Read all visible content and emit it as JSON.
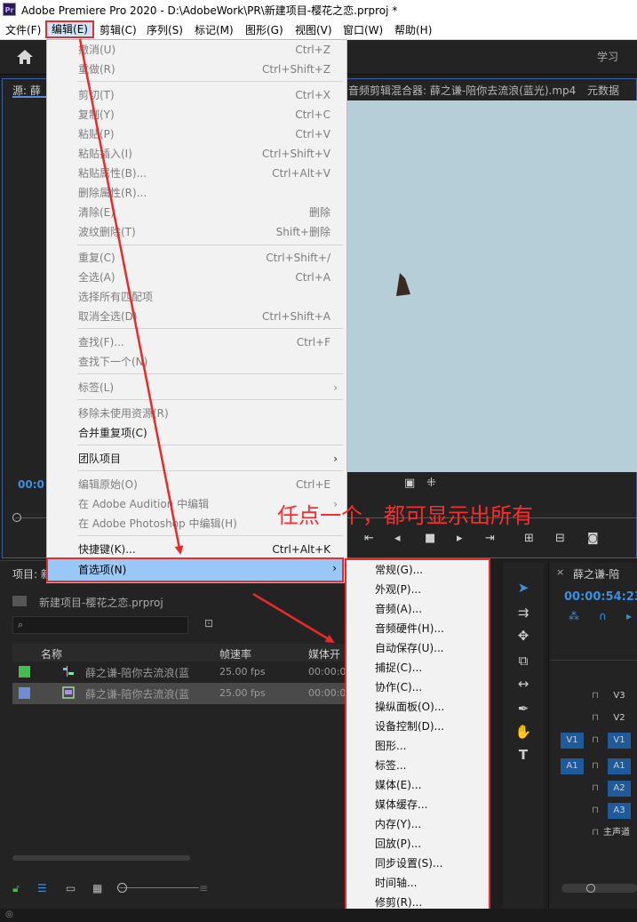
{
  "window": {
    "title": "Adobe Premiere Pro 2020 - D:\\AdobeWork\\PR\\新建项目-樱花之恋.prproj *",
    "icon_text": "Pr"
  },
  "menubar": [
    {
      "label": "文件(F)"
    },
    {
      "label": "编辑(E)"
    },
    {
      "label": "剪辑(C)"
    },
    {
      "label": "序列(S)"
    },
    {
      "label": "标记(M)"
    },
    {
      "label": "图形(G)"
    },
    {
      "label": "视图(V)"
    },
    {
      "label": "窗口(W)"
    },
    {
      "label": "帮助(H)"
    }
  ],
  "header": {
    "learn": "学习"
  },
  "source_panel": {
    "tab": "源: 薛",
    "mixer_tab": "音频剪辑混合器: 薛之谦-陪你去流浪(蓝光).mp4",
    "metadata_tab": "元数据",
    "timecode": "00:0"
  },
  "edit_menu": [
    {
      "label": "撤消(U)",
      "shortcut": "Ctrl+Z",
      "enabled": false
    },
    {
      "label": "重做(R)",
      "shortcut": "Ctrl+Shift+Z",
      "enabled": false
    },
    {
      "label": "剪切(T)",
      "shortcut": "Ctrl+X",
      "enabled": false
    },
    {
      "label": "复制(Y)",
      "shortcut": "Ctrl+C",
      "enabled": false
    },
    {
      "label": "粘贴(P)",
      "shortcut": "Ctrl+V",
      "enabled": false
    },
    {
      "label": "粘贴插入(I)",
      "shortcut": "Ctrl+Shift+V",
      "enabled": false
    },
    {
      "label": "粘贴属性(B)...",
      "shortcut": "Ctrl+Alt+V",
      "enabled": false
    },
    {
      "label": "删除属性(R)...",
      "shortcut": "",
      "enabled": false
    },
    {
      "label": "清除(E)",
      "shortcut": "删除",
      "enabled": false
    },
    {
      "label": "波纹删除(T)",
      "shortcut": "Shift+删除",
      "enabled": false
    },
    {
      "label": "重复(C)",
      "shortcut": "Ctrl+Shift+/",
      "enabled": false
    },
    {
      "label": "全选(A)",
      "shortcut": "Ctrl+A",
      "enabled": false
    },
    {
      "label": "选择所有匹配项",
      "shortcut": "",
      "enabled": false
    },
    {
      "label": "取消全选(D)",
      "shortcut": "Ctrl+Shift+A",
      "enabled": false
    },
    {
      "label": "查找(F)...",
      "shortcut": "Ctrl+F",
      "enabled": false
    },
    {
      "label": "查找下一个(N)",
      "shortcut": "",
      "enabled": false
    },
    {
      "label": "标签(L)",
      "shortcut": "",
      "enabled": false,
      "submenu": true
    },
    {
      "label": "移除未使用资源(R)",
      "shortcut": "",
      "enabled": false
    },
    {
      "label": "合并重复项(C)",
      "shortcut": "",
      "enabled": true
    },
    {
      "label": "团队项目",
      "shortcut": "",
      "enabled": true,
      "submenu": true
    },
    {
      "label": "编辑原始(O)",
      "shortcut": "Ctrl+E",
      "enabled": false
    },
    {
      "label": "在 Adobe Audition 中编辑",
      "shortcut": "",
      "enabled": false,
      "submenu": true
    },
    {
      "label": "在 Adobe Photoshop 中编辑(H)",
      "shortcut": "",
      "enabled": false
    },
    {
      "label": "快捷键(K)...",
      "shortcut": "Ctrl+Alt+K",
      "enabled": true
    },
    {
      "label": "首选项(N)",
      "shortcut": "",
      "enabled": true,
      "submenu": true
    }
  ],
  "preferences_submenu": [
    "常规(G)...",
    "外观(P)...",
    "音频(A)...",
    "音频硬件(H)...",
    "自动保存(U)...",
    "捕捉(C)...",
    "协作(C)...",
    "操纵面板(O)...",
    "设备控制(D)...",
    "图形...",
    "标签...",
    "媒体(E)...",
    "媒体缓存...",
    "内存(Y)...",
    "回放(P)...",
    "同步设置(S)...",
    "时间轴...",
    "修剪(R)..."
  ],
  "annotation": "任点一个，都可显示出所有",
  "project_panel": {
    "tab": "项目: 新",
    "project_name": "新建项目-樱花之恋.prproj",
    "columns": [
      "名称",
      "帧速率",
      "媒体开"
    ],
    "rows": [
      {
        "name": "薛之谦-陪你去流浪(蓝",
        "fps": "25.00 fps",
        "media": "00:00:00",
        "color": "#3fbf4f"
      },
      {
        "name": "薛之谦-陪你去流浪(蓝",
        "fps": "25.00 fps",
        "media": "00:00:00",
        "color": "#6b8fd6"
      }
    ]
  },
  "timeline": {
    "tab": "薛之谦-陪",
    "timecode": "00:00:54:23",
    "tracks": [
      {
        "src": "",
        "name": "V3"
      },
      {
        "src": "",
        "name": "V2"
      },
      {
        "src": "V1",
        "name": "V1"
      },
      {
        "src": "A1",
        "name": "A1"
      },
      {
        "src": "",
        "name": "A2"
      },
      {
        "src": "",
        "name": "A3"
      },
      {
        "src": "",
        "name": "主声道"
      }
    ]
  },
  "colors": {
    "accent": "#3b8fe0",
    "highlight_border": "#e03030",
    "menu_highlight": "#99c8f6"
  }
}
